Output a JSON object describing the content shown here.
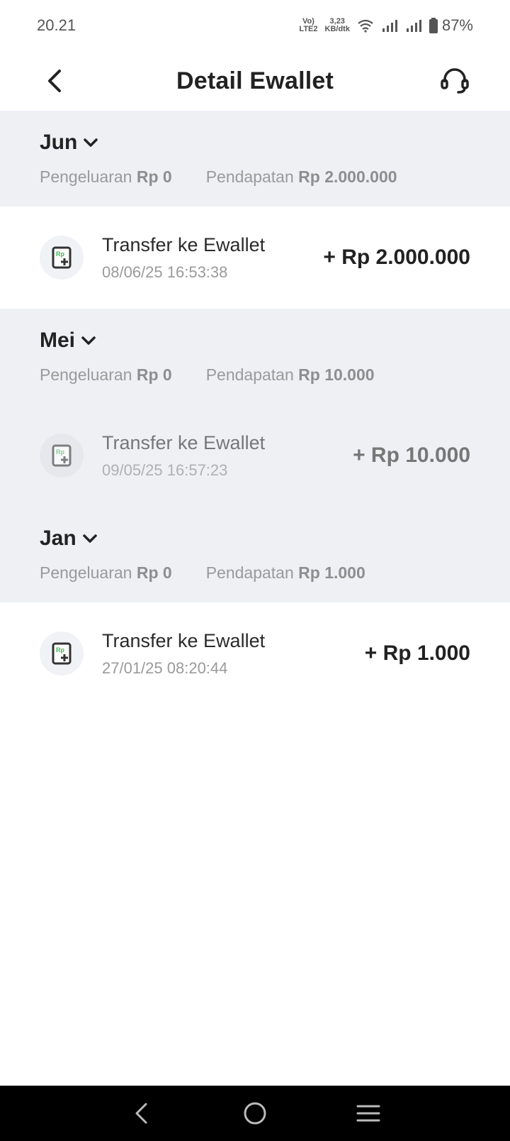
{
  "status_bar": {
    "time": "20.21",
    "network_label_top": "Vo)",
    "network_label_bottom": "LTE2",
    "speed_top": "3,23",
    "speed_bottom": "KB/dtk",
    "battery": "87%"
  },
  "header": {
    "title": "Detail Ewallet",
    "back_icon": "chevron-left-icon",
    "support_icon": "headset-icon"
  },
  "months": [
    {
      "name": "Jun",
      "expense_label": "Pengeluaran",
      "expense_value": "Rp 0",
      "income_label": "Pendapatan",
      "income_value": "Rp 2.000.000",
      "transactions": [
        {
          "title": "Transfer ke Ewallet",
          "date": "08/06/25 16:53:38",
          "amount": "+ Rp 2.000.000"
        }
      ]
    },
    {
      "name": "Mei",
      "expense_label": "Pengeluaran",
      "expense_value": "Rp 0",
      "income_label": "Pendapatan",
      "income_value": "Rp 10.000",
      "transactions": [
        {
          "title": "Transfer ke Ewallet",
          "date": "09/05/25 16:57:23",
          "amount": "+ Rp 10.000"
        }
      ]
    },
    {
      "name": "Jan",
      "expense_label": "Pengeluaran",
      "expense_value": "Rp 0",
      "income_label": "Pendapatan",
      "income_value": "Rp 1.000",
      "transactions": [
        {
          "title": "Transfer ke Ewallet",
          "date": "27/01/25 08:20:44",
          "amount": "+ Rp 1.000"
        }
      ]
    }
  ],
  "tx_icon_text": "Rp",
  "colors": {
    "section_bg": "#eef0f4",
    "accent_green": "#3dbb4f",
    "nav_bg": "#000000"
  }
}
